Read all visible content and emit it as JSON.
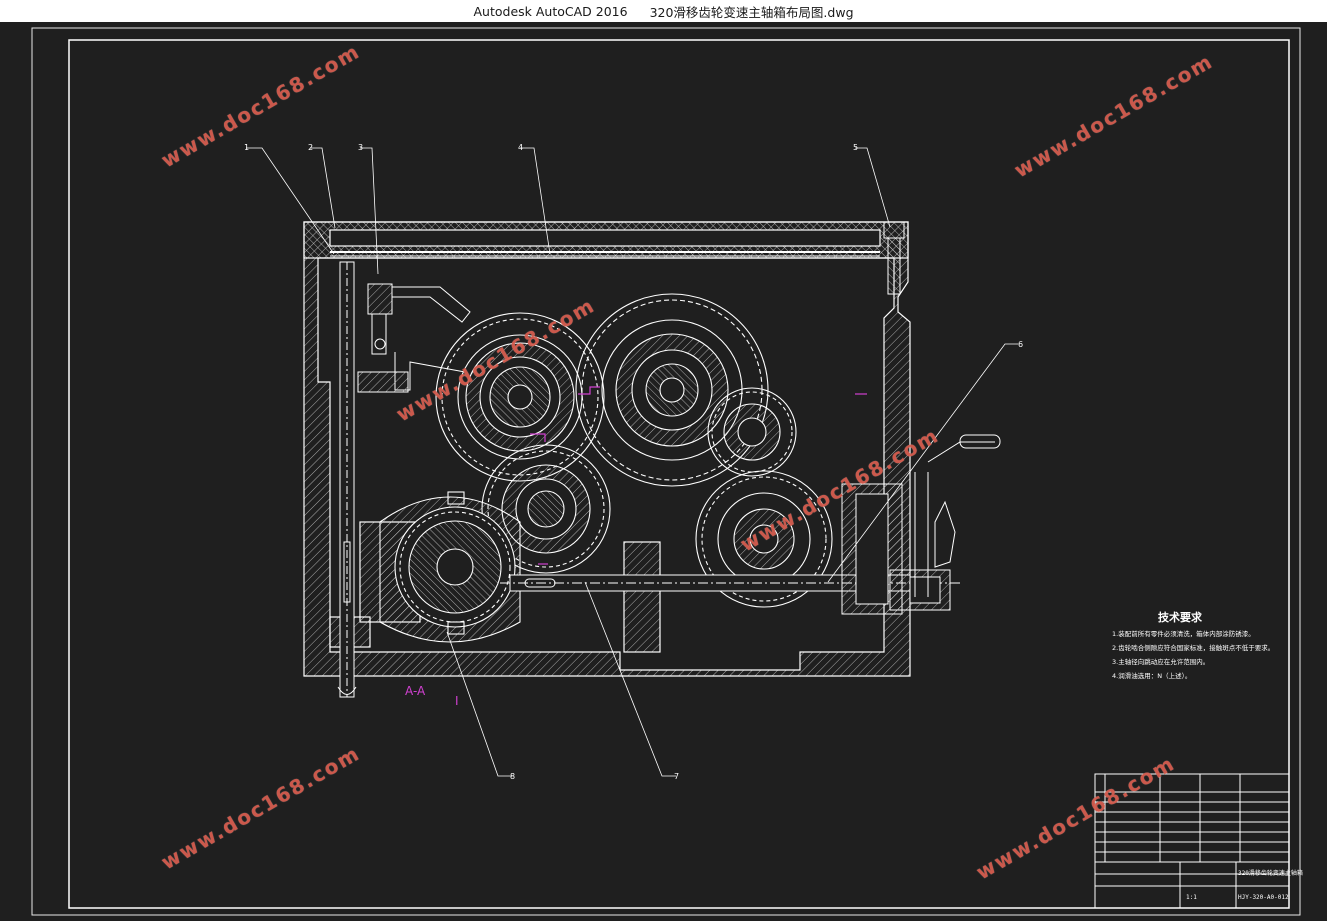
{
  "window": {
    "app_title": "Autodesk AutoCAD 2016",
    "file_name": "320滑移齿轮变速主轴箱布局图.dwg"
  },
  "watermarks": [
    "www.doc168.com",
    "www.doc168.com",
    "www.doc168.com",
    "www.doc168.com",
    "www.doc168.com",
    "www.doc168.com"
  ],
  "drawing": {
    "section_label": "A-A",
    "section_mark": "I",
    "balloons": [
      "1",
      "2",
      "3",
      "4",
      "5",
      "6",
      "7",
      "8"
    ],
    "tech_requirements": {
      "title": "技术要求",
      "items": [
        "1.装配前所有零件必须清洗，箱体内部涂防锈漆。",
        "2.齿轮啮合侧隙应符合国家标准，接触斑点不低于要求。",
        "3.主轴径向跳动应在允许范围内。",
        "4.润滑油选用：N（上述）。"
      ]
    },
    "title_block": {
      "drawing_no": "HJY-320-A0-012",
      "name": "320滑移齿轮变速主轴箱",
      "scale": "1:1"
    }
  },
  "colors": {
    "canvas": "#1f1f1f",
    "lines": "#ffffff",
    "annotation": "#d040d0",
    "watermark": "#d4584a"
  }
}
